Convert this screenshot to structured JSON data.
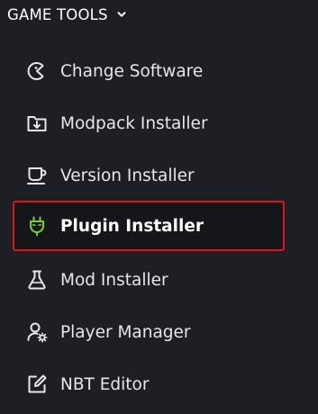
{
  "section": {
    "title": "GAME TOOLS",
    "chevron_icon": "chevron-down-icon"
  },
  "menu": {
    "items": [
      {
        "label": "Change Software",
        "icon": "software-icon"
      },
      {
        "label": "Modpack Installer",
        "icon": "download-folder-icon"
      },
      {
        "label": "Version Installer",
        "icon": "cup-icon"
      },
      {
        "label": "Plugin Installer",
        "icon": "plug-icon",
        "active": true
      },
      {
        "label": "Mod Installer",
        "icon": "flask-icon"
      },
      {
        "label": "Player Manager",
        "icon": "user-gear-icon"
      },
      {
        "label": "NBT Editor",
        "icon": "edit-icon"
      }
    ]
  },
  "colors": {
    "background": "#1e1f24",
    "text": "#e6e7ea",
    "active_border": "#e0141b",
    "active_icon": "#7ccf2a"
  }
}
